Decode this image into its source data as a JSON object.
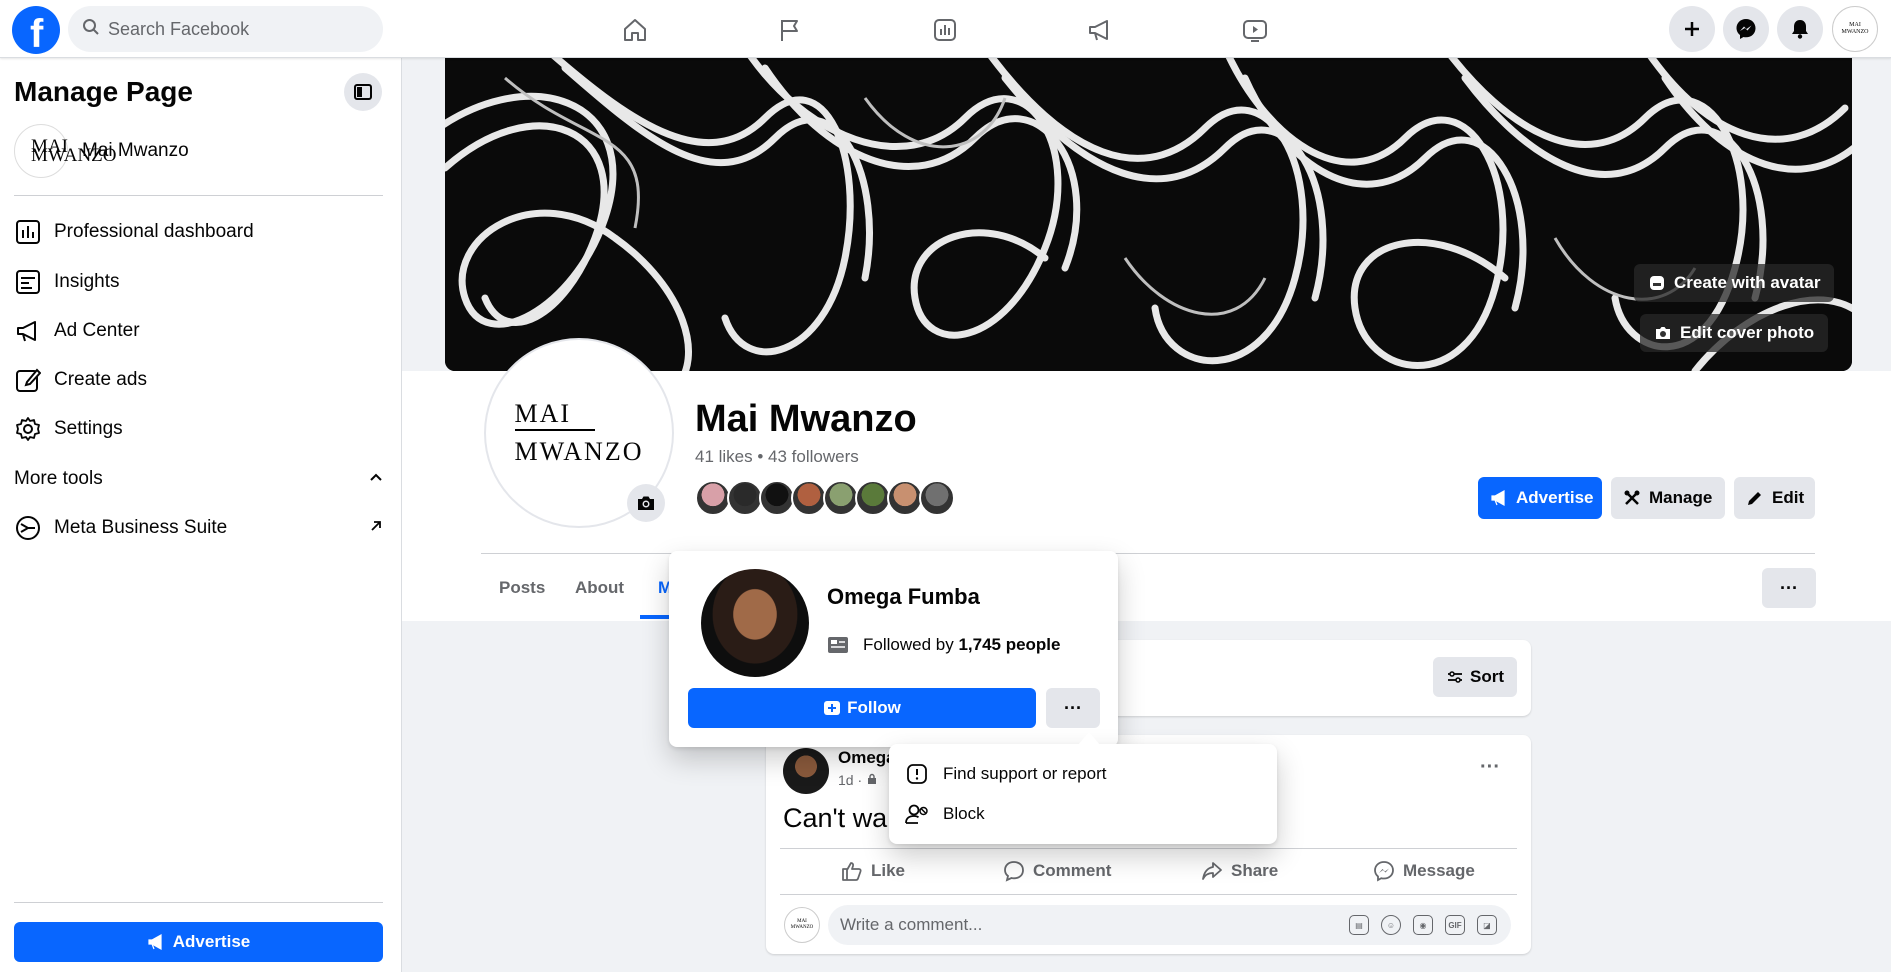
{
  "topbar": {
    "search_placeholder": "Search Facebook",
    "nav_icons": [
      "home-icon",
      "flag-icon",
      "insights-icon",
      "megaphone-icon",
      "video-icon"
    ],
    "right_icons": [
      "plus-icon",
      "messenger-icon",
      "bell-icon"
    ],
    "avatar_text": "MAI MWANZO"
  },
  "sidebar": {
    "title": "Manage Page",
    "page_name": "Mai Mwanzo",
    "page_avatar_text": "MAI MWANZO",
    "items": [
      {
        "label": "Professional dashboard",
        "icon": "dashboard-icon"
      },
      {
        "label": "Insights",
        "icon": "insights-icon"
      },
      {
        "label": "Ad Center",
        "icon": "megaphone-icon"
      },
      {
        "label": "Create ads",
        "icon": "pencil-icon"
      },
      {
        "label": "Settings",
        "icon": "gear-icon"
      }
    ],
    "more_tools_label": "More tools",
    "meta_suite_label": "Meta Business Suite",
    "advertise_label": "Advertise"
  },
  "cover": {
    "create_avatar_label": "Create with avatar",
    "edit_cover_label": "Edit cover photo"
  },
  "profile": {
    "logo_line1": "MAI",
    "logo_line2": "MWANZO",
    "name": "Mai Mwanzo",
    "stats": "41 likes • 43 followers",
    "follower_avatar_colors": [
      "#d8a0a8",
      "#2a2a2a",
      "#111111",
      "#b06040",
      "#8aa070",
      "#5a7a3a",
      "#c89070",
      "#707070"
    ],
    "advertise_label": "Advertise",
    "manage_label": "Manage",
    "edit_label": "Edit"
  },
  "tabs": {
    "items": [
      "Posts",
      "About",
      "M"
    ],
    "more_label": "···"
  },
  "feed": {
    "sort_label": "Sort",
    "post": {
      "author": "Omega",
      "time": "1d ·",
      "text": "Can't wai",
      "more_label": "···",
      "actions": [
        "Like",
        "Comment",
        "Share",
        "Message"
      ]
    },
    "comment_placeholder": "Write a comment...",
    "comment_avatar_text": "MAI MWANZO",
    "comment_icons": [
      "sticker-icon",
      "emoji-icon",
      "camera-icon",
      "gif-icon",
      "sticker2-icon"
    ]
  },
  "hover_card": {
    "name": "Omega Fumba",
    "followed_prefix": "Followed by ",
    "followed_count": "1,745 people",
    "follow_label": "Follow",
    "more_label": "···"
  },
  "dropdown": {
    "items": [
      {
        "label": "Find support or report",
        "icon": "report-icon"
      },
      {
        "label": "Block",
        "icon": "block-user-icon"
      }
    ]
  },
  "colors": {
    "brand_blue": "#0866ff",
    "gray_button": "#e4e6eb",
    "background": "#f0f2f5"
  }
}
